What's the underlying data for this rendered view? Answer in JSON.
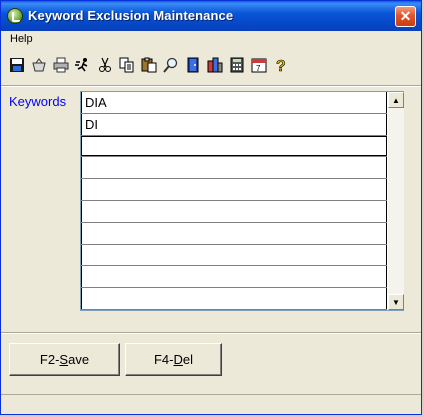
{
  "window": {
    "title": "Keyword Exclusion Maintenance",
    "close_symbol": "✕"
  },
  "menu": {
    "items": [
      "Help"
    ]
  },
  "toolbar": {
    "icons": [
      "save-icon",
      "basket-icon",
      "print-icon",
      "run-icon",
      "cut-icon",
      "copy-icon",
      "paste-icon",
      "find-icon",
      "exit-door-icon",
      "building-icon",
      "calculator-icon",
      "calendar-icon",
      "help-icon"
    ]
  },
  "keywords": {
    "label": "Keywords",
    "rows": [
      "DIA",
      "DI",
      "",
      "",
      "",
      "",
      "",
      "",
      "",
      "",
      ""
    ]
  },
  "buttons": {
    "save_prefix": "F2-",
    "save_mnemonic": "S",
    "save_suffix": "ave",
    "del_prefix": "F4-",
    "del_mnemonic": "D",
    "del_suffix": "el"
  }
}
